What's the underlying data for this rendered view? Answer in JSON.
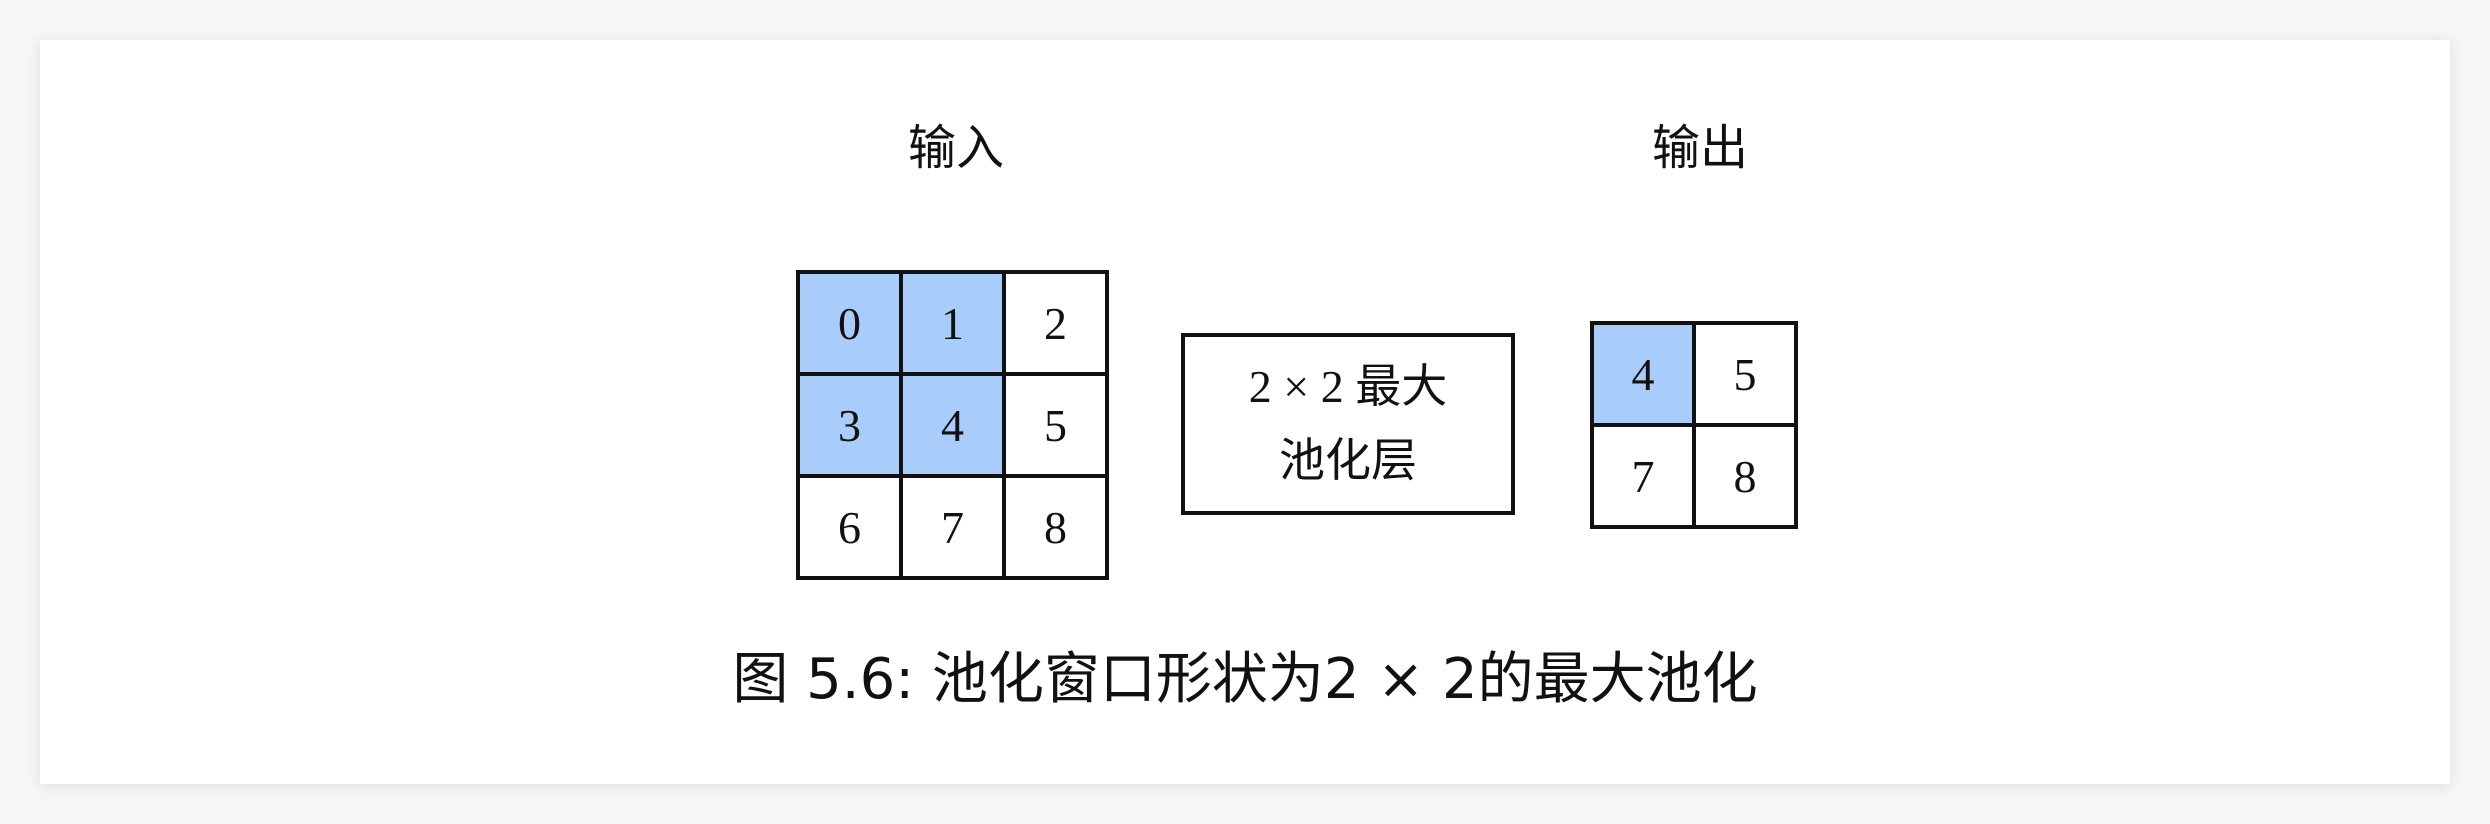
{
  "input_label": "输入",
  "output_label": "输出",
  "input_grid": [
    {
      "value": "0",
      "highlighted": true
    },
    {
      "value": "1",
      "highlighted": true
    },
    {
      "value": "2",
      "highlighted": false
    },
    {
      "value": "3",
      "highlighted": true
    },
    {
      "value": "4",
      "highlighted": true
    },
    {
      "value": "5",
      "highlighted": false
    },
    {
      "value": "6",
      "highlighted": false
    },
    {
      "value": "7",
      "highlighted": false
    },
    {
      "value": "8",
      "highlighted": false
    }
  ],
  "output_grid": [
    {
      "value": "4",
      "highlighted": true
    },
    {
      "value": "5",
      "highlighted": false
    },
    {
      "value": "7",
      "highlighted": false
    },
    {
      "value": "8",
      "highlighted": false
    }
  ],
  "pool_box": {
    "line1": "2 × 2 最大",
    "line2": "池化层"
  },
  "caption": "图 5.6: 池化窗口形状为2 × 2的最大池化",
  "colors": {
    "highlight": "#a9cdfb",
    "border": "#111111",
    "background": "#ffffff"
  }
}
